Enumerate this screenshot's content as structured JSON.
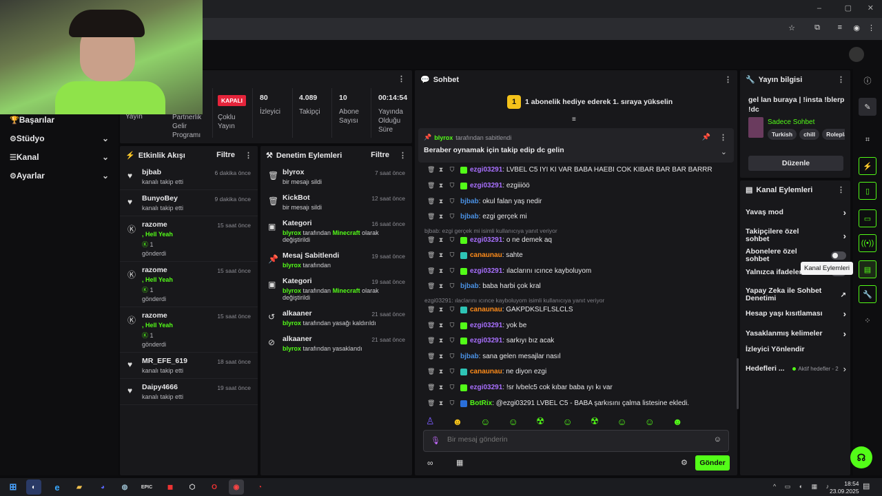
{
  "window": {
    "minimize": "–",
    "maximize": "▢",
    "close": "✕"
  },
  "left_nav": [
    {
      "label": "Başarılar",
      "icon": "trophy-icon",
      "glyph": "🏆",
      "chev": false
    },
    {
      "label": "Stüdyo",
      "icon": "gear-icon",
      "glyph": "⚙",
      "chev": true
    },
    {
      "label": "Kanal",
      "icon": "sliders-icon",
      "glyph": "☰",
      "chev": true
    },
    {
      "label": "Ayarlar",
      "icon": "settings-icon",
      "glyph": "⚙",
      "chev": true
    }
  ],
  "stats": {
    "yayin_label": "Yayın",
    "partner_label": "Partnerlik Gelir Programı",
    "kapali": "KAPALI",
    "coklu_label": "Çoklu Yayın",
    "izleyici": {
      "v": "80",
      "l": "İzleyici"
    },
    "takipci": {
      "v": "4.089",
      "l": "Takipçi"
    },
    "abone": {
      "v": "10",
      "l": "Abone Sayısı"
    },
    "sure": {
      "v": "00:14:54",
      "l": "Yayında Olduğu Süre"
    }
  },
  "activity": {
    "title": "Etkinlik Akışı",
    "filter": "Filtre",
    "items": [
      {
        "name": "bjbab",
        "sub": "kanalı takip etti",
        "time": "6 dakika önce",
        "type": "follow"
      },
      {
        "name": "BunyoBey",
        "sub": "kanalı takip etti",
        "time": "9 dakika önce",
        "type": "follow"
      },
      {
        "name": "razome",
        "sub": ", Hell Yeah",
        "n": "1",
        "sub2": "gönderdi",
        "time": "15 saat önce",
        "type": "kick"
      },
      {
        "name": "razome",
        "sub": ", Hell Yeah",
        "n": "1",
        "sub2": "gönderdi",
        "time": "15 saat önce",
        "type": "kick"
      },
      {
        "name": "razome",
        "sub": ", Hell Yeah",
        "n": "1",
        "sub2": "gönderdi",
        "time": "15 saat önce",
        "type": "kick"
      },
      {
        "name": "MR_EFE_619",
        "sub": "kanalı takip etti",
        "time": "18 saat önce",
        "type": "follow"
      },
      {
        "name": "Daipy4666",
        "sub": "kanalı takip etti",
        "time": "19 saat önce",
        "type": "follow"
      }
    ]
  },
  "moderation": {
    "title": "Denetim Eylemleri",
    "filter": "Filtre",
    "items": [
      {
        "name": "blyrox",
        "pre": "",
        "mid": "bir mesajı sildi",
        "hl": "",
        "post": "",
        "time": "7 saat önce",
        "glyph": "🗑"
      },
      {
        "name": "KickBot",
        "pre": "",
        "mid": "bir mesajı sildi",
        "hl": "",
        "post": "",
        "time": "12 saat önce",
        "glyph": "🗑"
      },
      {
        "name": "Kategori",
        "pre": "blyrox",
        "mid": " tarafından ",
        "hl": "Minecraft",
        "post": " olarak değiştirildi",
        "time": "16 saat önce",
        "glyph": "▣"
      },
      {
        "name": "Mesaj Sabitlendi",
        "pre": "blyrox",
        "mid": " tarafından",
        "hl": "",
        "post": "",
        "time": "19 saat önce",
        "glyph": "📌"
      },
      {
        "name": "Kategori",
        "pre": "blyrox",
        "mid": " tarafından ",
        "hl": "Minecraft",
        "post": " olarak değiştirildi",
        "time": "19 saat önce",
        "glyph": "▣"
      },
      {
        "name": "alkaaner",
        "pre": "blyrox",
        "mid": " tarafından yasağı kaldırıldı",
        "hl": "",
        "post": "",
        "time": "21 saat önce",
        "glyph": "↺"
      },
      {
        "name": "alkaaner",
        "pre": "blyrox",
        "mid": " tarafından yasaklandı",
        "hl": "",
        "post": "",
        "time": "21 saat önce",
        "glyph": "⊘"
      }
    ]
  },
  "chat": {
    "title": "Sohbet",
    "gift_banner": "1 abonelik hediye ederek 1. sıraya yükselin",
    "gift_rank": "1",
    "pinned_by": "blyrox",
    "pinned_suffix": "tarafından sabitlendi",
    "pinned_text": "Beraber oynamak için takip edip dc gelin",
    "messages": [
      {
        "user": "ezgi03291",
        "color": "#a970ff",
        "text": ": LVBEL C5 IYI KI VAR BABA HAEBI COK KIBAR BAR BAR BARRR",
        "badge": "#53fc18"
      },
      {
        "user": "ezgi03291",
        "color": "#a970ff",
        "text": ": ezgiiiöö",
        "badge": "#53fc18"
      },
      {
        "user": "bjbab",
        "color": "#4a90e2",
        "text": ": okul falan yaş nedir",
        "badge": ""
      },
      {
        "user": "bjbab",
        "color": "#4a90e2",
        "text": ": ezgi gerçek mi",
        "badge": ""
      },
      {
        "user": "ezgi03291",
        "color": "#a970ff",
        "text": ": o ne demek aq",
        "badge": "#53fc18"
      },
      {
        "user": "canaunau",
        "color": "#ff8c1a",
        "text": ": sahte",
        "badge": "#2ec4b6"
      },
      {
        "user": "ezgi03291",
        "color": "#a970ff",
        "text": ": ılaclarını ıcınce kayboluyom",
        "badge": "#53fc18"
      },
      {
        "user": "bjbab",
        "color": "#4a90e2",
        "text": ": baba harbi çok kral",
        "badge": ""
      },
      {
        "user": "canaunau",
        "color": "#ff8c1a",
        "text": ": GAKPDKSLFLSLCLS",
        "badge": "#2ec4b6"
      },
      {
        "user": "ezgi03291",
        "color": "#a970ff",
        "text": ": yok be",
        "badge": "#53fc18"
      },
      {
        "user": "ezgi03291",
        "color": "#a970ff",
        "text": ": sarkıyı bız acak",
        "badge": "#53fc18"
      },
      {
        "user": "bjbab",
        "color": "#4a90e2",
        "text": ": sana gelen mesajlar nasıl",
        "badge": ""
      },
      {
        "user": "canaunau",
        "color": "#ff8c1a",
        "text": ": ne diyon ezgi",
        "badge": "#2ec4b6"
      },
      {
        "user": "ezgi03291",
        "color": "#a970ff",
        "text": ": !sr lvbelc5 cok kıbar baba ıyı kı var",
        "badge": "#53fc18"
      },
      {
        "user": "BotRix",
        "color": "#53fc18",
        "text": ": @ezgi03291 LVBEL C5 - BABA şarkısını çalma listesine ekledi.",
        "badge": "#2a6fdb"
      }
    ],
    "reply1": "bjbab: ezgi gerçek mi isimli kullanıcıya yanıt veriyor",
    "reply2": "ezgi03291: ılaclarını ıcınce kayboluyom isimli kullanıcıya yanıt veriyor",
    "input_placeholder": "Bir mesaj gönderin",
    "send": "Gönder"
  },
  "stream_info": {
    "title": "Yayın bilgisi",
    "stream_title": "gel lan buraya | !insta !blerp !dc",
    "category": "Sadece Sohbet",
    "tags": [
      "Turkish",
      "chill",
      "Roleplay"
    ],
    "edit": "Düzenle"
  },
  "channel_actions": {
    "title": "Kanal Eylemleri",
    "items": [
      {
        "label": "Yavaş mod",
        "ctl": "chev"
      },
      {
        "label": "Takipçilere özel sohbet",
        "ctl": "chev"
      },
      {
        "label": "Abonelere özel sohbet",
        "ctl": "toggle"
      },
      {
        "label": "Yalnızca ifadelerle",
        "ctl": "toggle"
      },
      {
        "label": "Yapay Zeka ile Sohbet Denetimi",
        "ctl": "ext"
      },
      {
        "label": "Hesap yaşı kısıtlaması",
        "ctl": "chev"
      },
      {
        "label": "Yasaklanmış kelimeler",
        "ctl": "chev"
      },
      {
        "label": "İzleyici Yönlendir",
        "ctl": "none"
      },
      {
        "label": "Hedefleri ...",
        "ctl": "goal"
      }
    ],
    "goal_status": "Aktif hedefler - 2",
    "tooltip": "Kanal Eylemleri"
  },
  "taskbar": {
    "time": "18:54",
    "date": "23.09.2025"
  }
}
